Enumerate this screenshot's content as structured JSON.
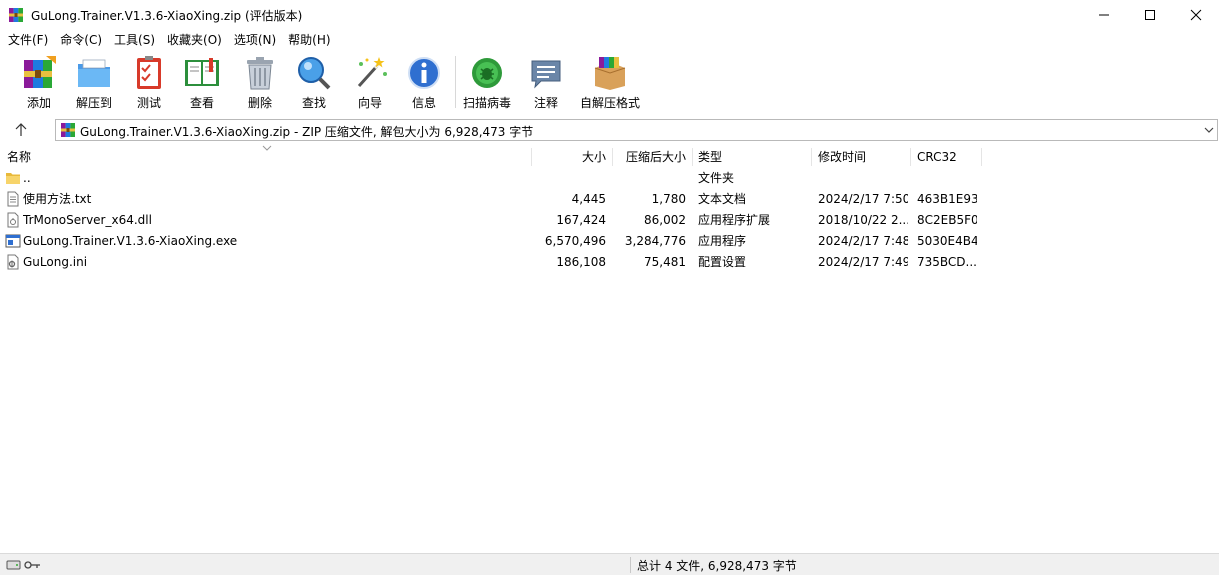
{
  "window": {
    "title": "GuLong.Trainer.V1.3.6-XiaoXing.zip (评估版本)"
  },
  "menu": [
    "文件(F)",
    "命令(C)",
    "工具(S)",
    "收藏夹(O)",
    "选项(N)",
    "帮助(H)"
  ],
  "toolbar": {
    "buttons": [
      {
        "label": "添加",
        "icon": "add-archive-icon"
      },
      {
        "label": "解压到",
        "icon": "extract-to-icon"
      },
      {
        "label": "测试",
        "icon": "test-icon"
      },
      {
        "label": "查看",
        "icon": "view-icon"
      },
      {
        "label": "删除",
        "icon": "delete-icon"
      },
      {
        "label": "查找",
        "icon": "find-icon"
      },
      {
        "label": "向导",
        "icon": "wizard-icon"
      },
      {
        "label": "信息",
        "icon": "info-icon"
      },
      {
        "label": "扫描病毒",
        "icon": "virus-scan-icon"
      },
      {
        "label": "注释",
        "icon": "comment-icon"
      },
      {
        "label": "自解压格式",
        "icon": "sfx-icon"
      }
    ]
  },
  "address": {
    "path": "GuLong.Trainer.V1.3.6-XiaoXing.zip - ZIP 压缩文件, 解包大小为 6,928,473 字节"
  },
  "columns": {
    "name": "名称",
    "size": "大小",
    "packed": "压缩后大小",
    "type": "类型",
    "modified": "修改时间",
    "crc": "CRC32"
  },
  "files": [
    {
      "name": "..",
      "size": "",
      "packed": "",
      "type": "文件夹",
      "modified": "",
      "crc": "",
      "icon": "folder-icon"
    },
    {
      "name": "使用方法.txt",
      "size": "4,445",
      "packed": "1,780",
      "type": "文本文档",
      "modified": "2024/2/17 7:50",
      "crc": "463B1E93",
      "icon": "text-file-icon"
    },
    {
      "name": "TrMonoServer_x64.dll",
      "size": "167,424",
      "packed": "86,002",
      "type": "应用程序扩展",
      "modified": "2018/10/22 2...",
      "crc": "8C2EB5F0",
      "icon": "dll-file-icon"
    },
    {
      "name": "GuLong.Trainer.V1.3.6-XiaoXing.exe",
      "size": "6,570,496",
      "packed": "3,284,776",
      "type": "应用程序",
      "modified": "2024/2/17 7:48",
      "crc": "5030E4B4",
      "icon": "exe-file-icon"
    },
    {
      "name": "GuLong.ini",
      "size": "186,108",
      "packed": "75,481",
      "type": "配置设置",
      "modified": "2024/2/17 7:49",
      "crc": "735BCD...",
      "icon": "ini-file-icon"
    }
  ],
  "status": {
    "summary": "总计 4 文件, 6,928,473 字节"
  }
}
